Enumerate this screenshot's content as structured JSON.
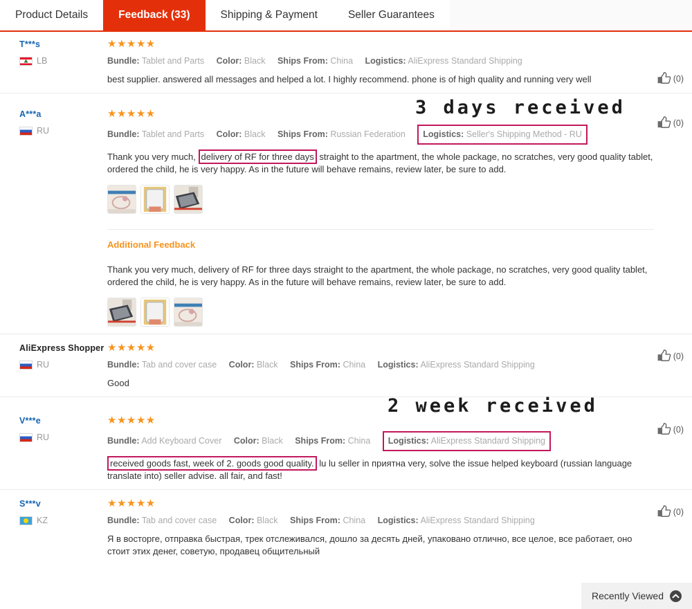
{
  "tabs": [
    {
      "label": "Product Details",
      "active": false
    },
    {
      "label": "Feedback (33)",
      "active": true
    },
    {
      "label": "Shipping & Payment",
      "active": false
    },
    {
      "label": "Seller Guarantees",
      "active": false
    }
  ],
  "colors": {
    "active_tab_bg": "#e4300a",
    "star": "#f7941e",
    "username": "#1466b3",
    "highlight_box": "#c2185b",
    "additional_feedback_title": "#f7941e"
  },
  "labels": {
    "bundle": "Bundle:",
    "color": "Color:",
    "ships_from": "Ships From:",
    "logistics": "Logistics:",
    "additional_feedback": "Additional Feedback",
    "helpful_count": "(0)",
    "stars_5": "★★★★★"
  },
  "annotations": [
    {
      "text": "3 days received"
    },
    {
      "text": "2 week received"
    }
  ],
  "reviews": [
    {
      "buyer": "T***s",
      "country_code": "LB",
      "flag": "lb-flag-icon",
      "stars": "★★★★★",
      "bundle": "Tablet and Parts",
      "color": "Black",
      "ships_from": "China",
      "logistics": "AliExpress Standard Shipping",
      "text": "best supplier. answered all messages and helped a lot. I highly recommend. phone is of high quality and running very well",
      "helpful": "(0)"
    },
    {
      "buyer": "A***a",
      "country_code": "RU",
      "flag": "ru-flag-icon",
      "stars": "★★★★★",
      "bundle": "Tablet and Parts",
      "color": "Black",
      "ships_from": "Russian Federation",
      "logistics": "Seller's Shipping Method - RU",
      "text_pre": "Thank you very much, ",
      "text_highlight": "delivery of RF for three days",
      "text_post": " straight to the apartment, the whole package, no scratches, very good quality tablet, ordered the child, he is very happy. As in the future will behave remains, review later, be sure to add.",
      "additional_feedback_title": "Additional Feedback",
      "additional_feedback_text": "Thank you very much, delivery of RF for three days straight to the apartment, the whole package, no scratches, very good quality tablet, ordered the child, he is very happy. As in the future will behave remains, review later, be sure to add.",
      "helpful": "(0)"
    },
    {
      "buyer": "AliExpress Shopper",
      "country_code": "RU",
      "flag": "ru-flag-icon",
      "stars": "★★★★★",
      "bundle": "Tab and cover case",
      "color": "Black",
      "ships_from": "China",
      "logistics": "AliExpress Standard Shipping",
      "text": "Good",
      "helpful": "(0)"
    },
    {
      "buyer": "V***e",
      "country_code": "RU",
      "flag": "ru-flag-icon",
      "stars": "★★★★★",
      "bundle": "Add Keyboard Cover",
      "color": "Black",
      "ships_from": "China",
      "logistics": "AliExpress Standard Shipping",
      "text_highlight": "received goods fast, week of 2. goods good quality.",
      "text_post": " lu lu seller in приятна very, solve the issue helped keyboard (russian language translate into) seller advise. all fair, and fast!",
      "helpful": "(0)"
    },
    {
      "buyer": "S***v",
      "country_code": "KZ",
      "flag": "kz-flag-icon",
      "stars": "★★★★★",
      "bundle": "Tab and cover case",
      "color": "Black",
      "ships_from": "China",
      "logistics": "AliExpress Standard Shipping",
      "text": "Я в восторге, отправка быстрая, трек отслеживался, дошло за десять дней, упаковано отлично, все целое, все работает, оно стоит этих денег, советую, продавец общительный",
      "helpful": "(0)"
    }
  ],
  "recently_viewed": {
    "label": "Recently Viewed",
    "icon": "chevron-up-icon"
  }
}
